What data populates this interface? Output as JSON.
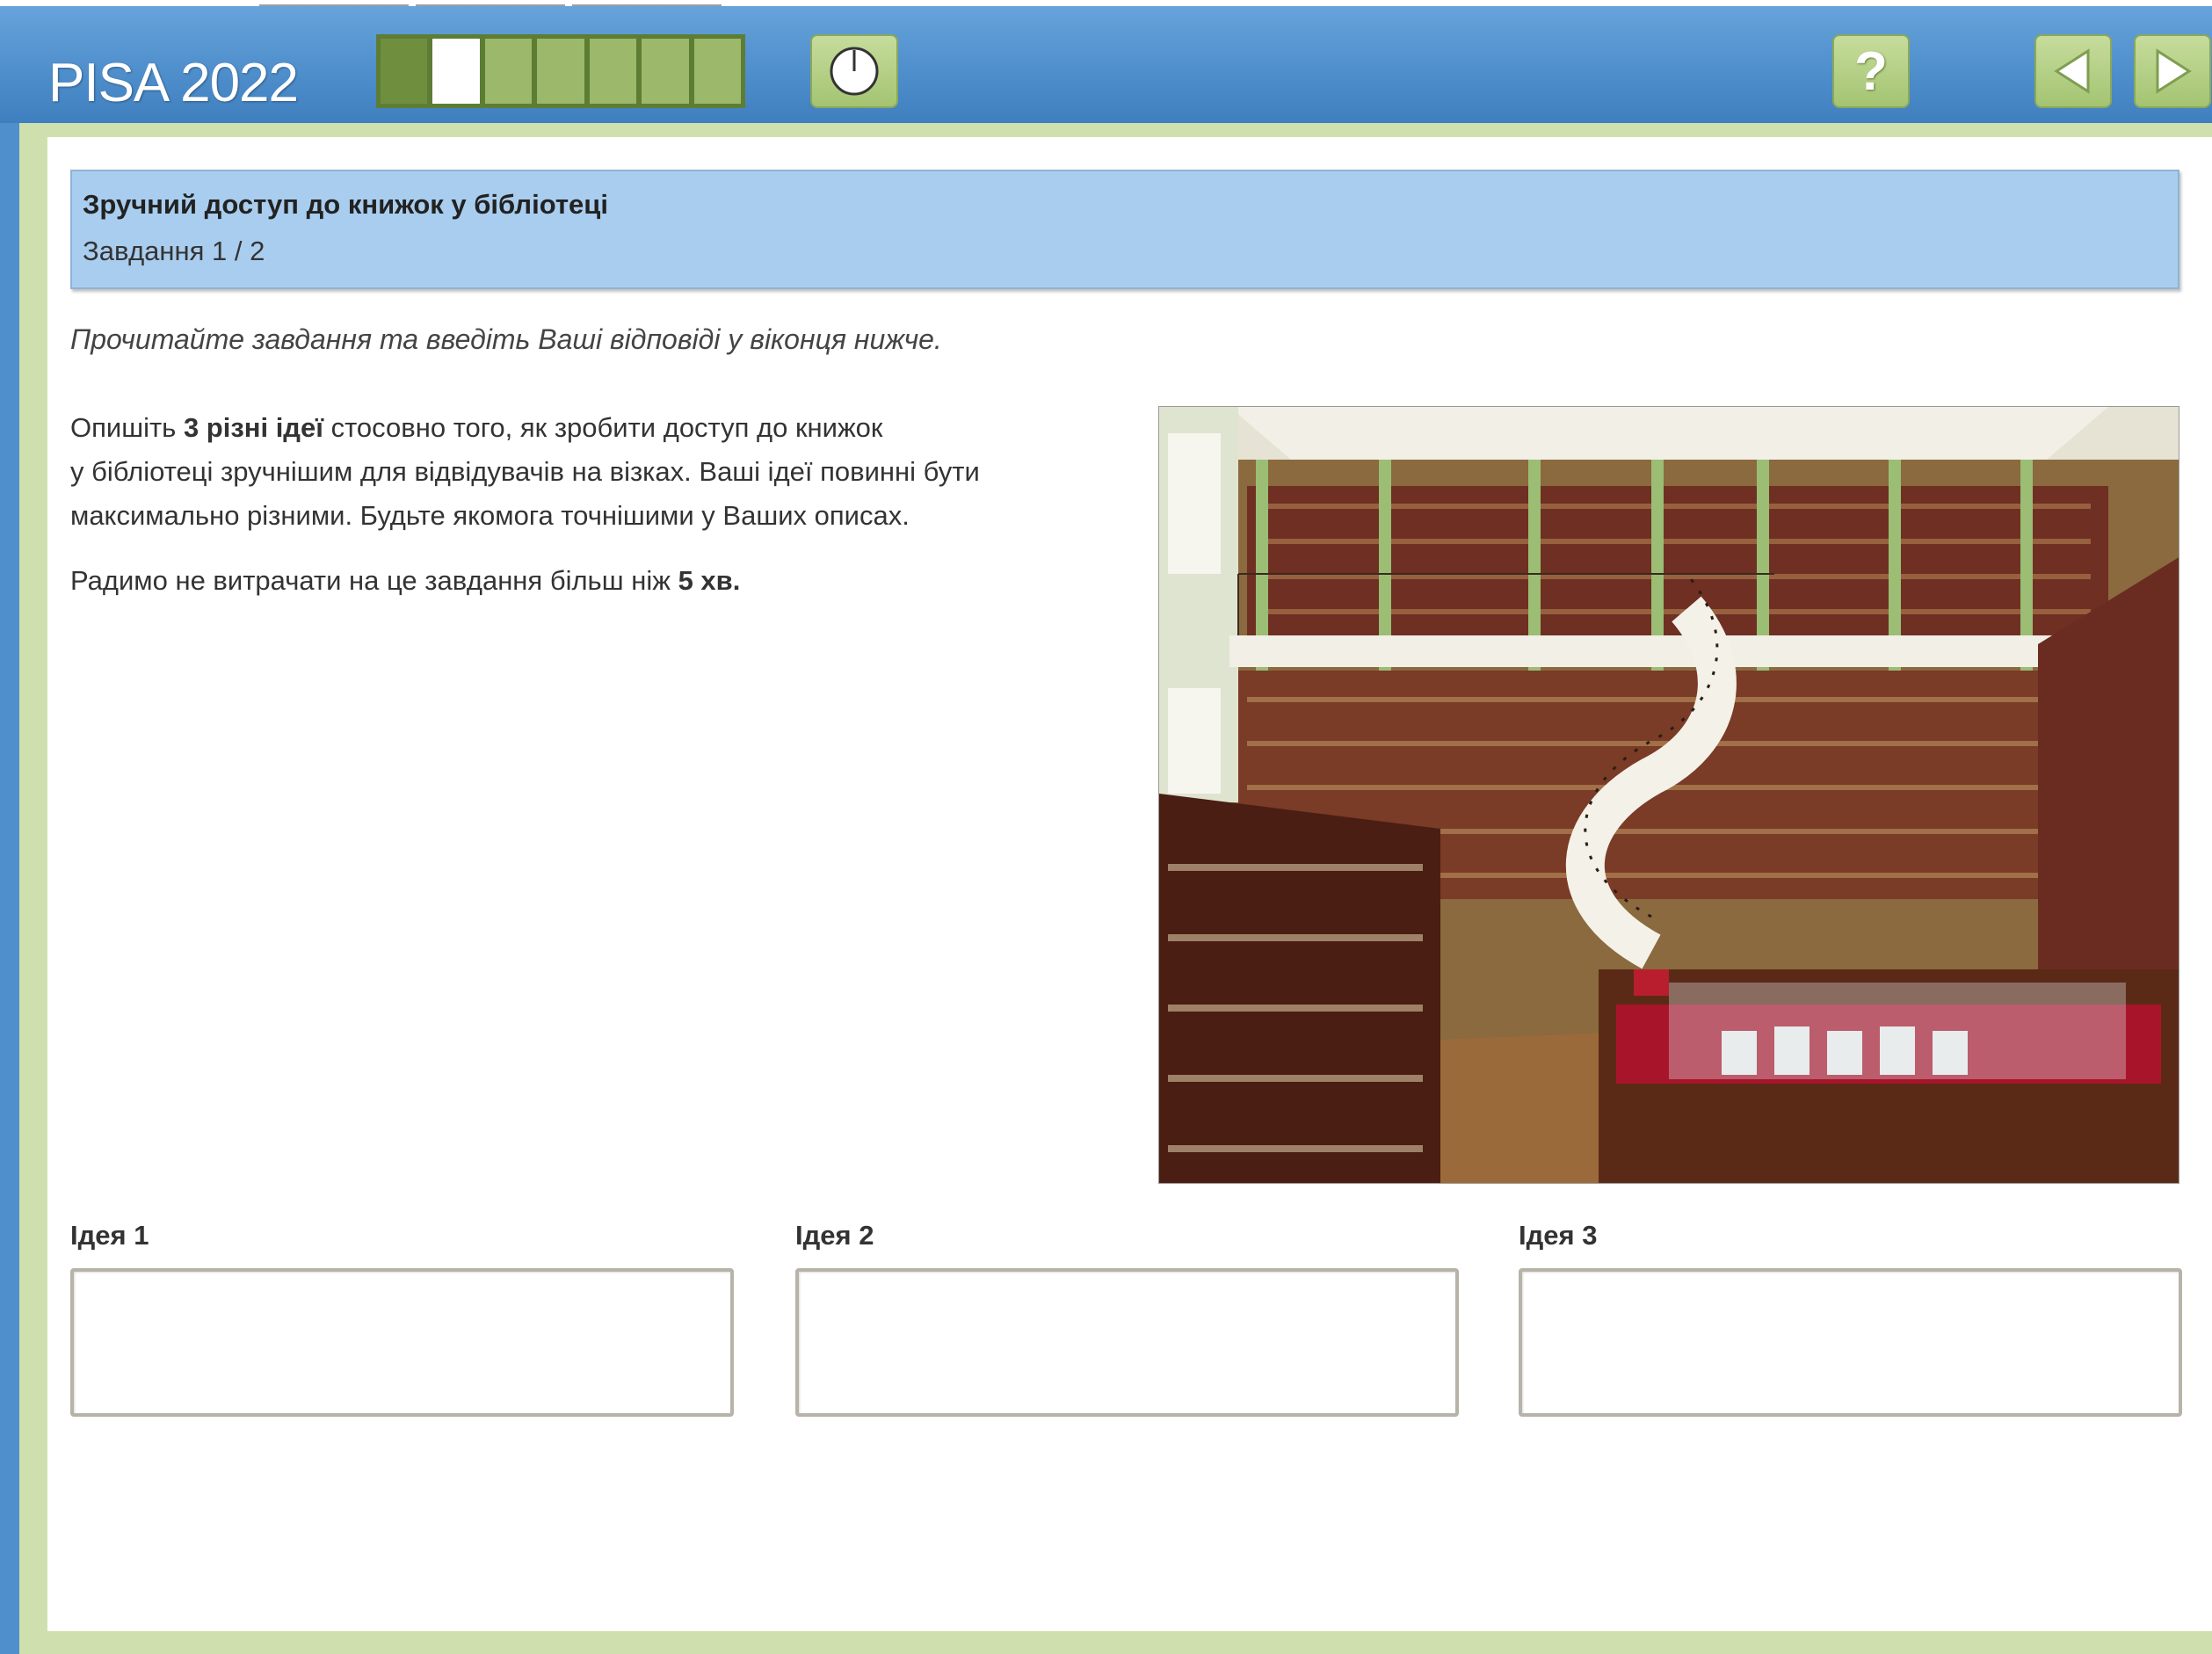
{
  "header": {
    "brand": "PISA 2022",
    "progress": {
      "total_segments": 7,
      "completed": 1,
      "current_index": 1
    },
    "timer_icon": "timer-icon",
    "help_icon": "help-icon",
    "prev_icon": "arrow-left-icon",
    "next_icon": "arrow-right-icon",
    "help_glyph": "?"
  },
  "task_header": {
    "title": "Зручний доступ до книжок у бібліотеці",
    "subtitle": "Завдання 1 / 2"
  },
  "instruction": "Прочитайте завдання та введіть Ваші відповіді у віконця нижче.",
  "task_text": {
    "p1_pre": "Опишіть ",
    "p1_bold": "3 різні ідеї",
    "p1_line1_rest": " стосовно того, як зробити доступ до книжок",
    "p1_line2": "у бібліотеці зручнішим для відвідувачів на візках. Ваші ідеї повинні бути",
    "p1_line3": "максимально різними. Будьте якомога точнішими у Ваших описах.",
    "p2_pre": "Радимо не витрачати на це завдання більш ніж ",
    "p2_bold": "5 хв."
  },
  "ideas": [
    {
      "label": "Ідея 1",
      "value": ""
    },
    {
      "label": "Ідея 2",
      "value": ""
    },
    {
      "label": "Ідея 3",
      "value": ""
    }
  ],
  "colors": {
    "header_blue": "#4f8fcc",
    "title_bar": "#a9cdee",
    "frame_green": "#cfe0ae",
    "button_green": "#a4c472"
  }
}
